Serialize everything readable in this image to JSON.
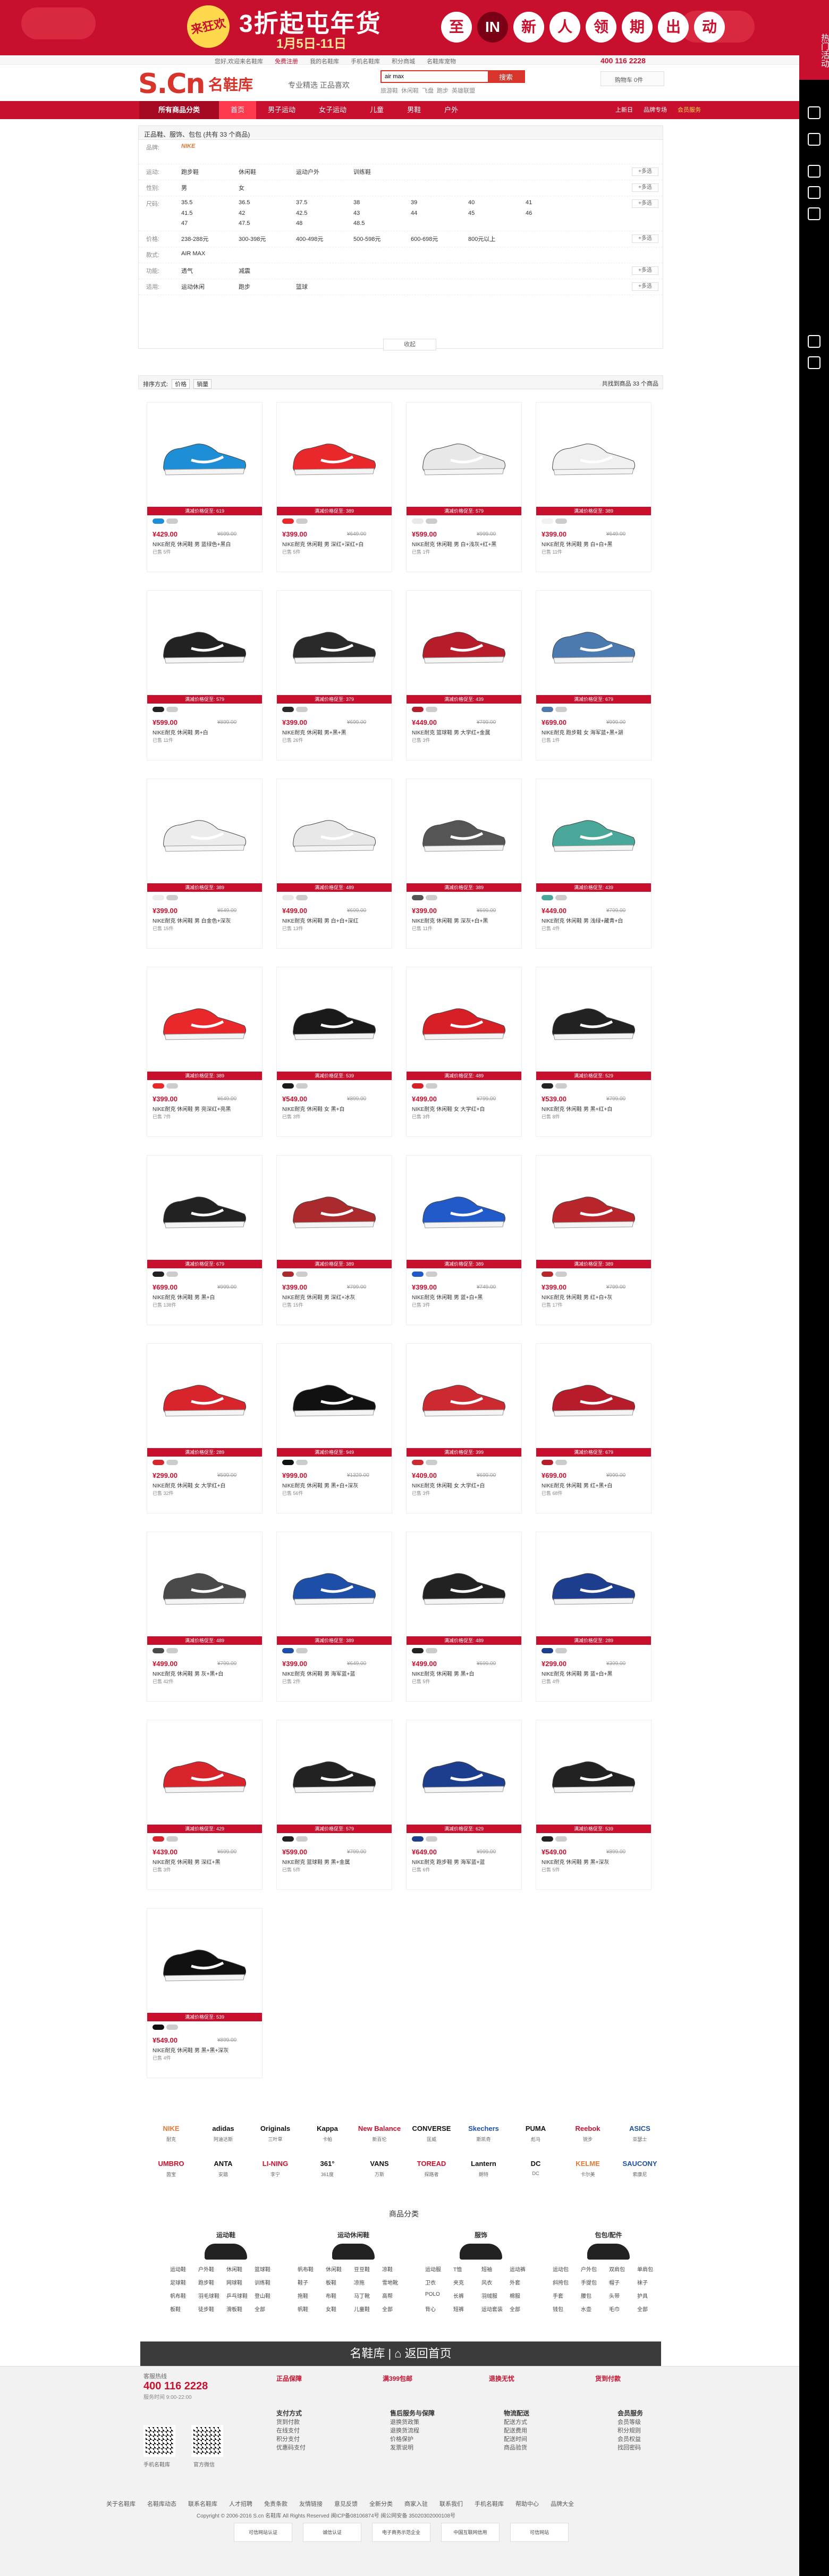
{
  "promo": {
    "badge": "来狂欢",
    "headline": "3折起屯年货",
    "dates": "1月5日-11日",
    "chips": [
      "至",
      "IN",
      "新",
      "人",
      "领",
      "期",
      "出",
      "动"
    ]
  },
  "side": {
    "hot": "热门活动"
  },
  "topbar": {
    "links": [
      "您好,欢迎来名鞋库",
      "免费注册",
      "我的名鞋库",
      "手机名鞋库",
      "积分商城",
      "名鞋库宠物"
    ],
    "phone": "400 116 2228"
  },
  "header": {
    "logo": "S.Cn",
    "logo_cn": "名鞋库",
    "slogan": "专业精选 正品喜欢",
    "search_value": "air max",
    "search_button": "搜索",
    "hotwords": [
      "旅游鞋",
      "休闲鞋",
      "飞盘",
      "跑步",
      "英雄联盟"
    ],
    "cart": "购物车 0件"
  },
  "nav": {
    "all": "所有商品分类",
    "items": [
      "首页",
      "男子运动",
      "女子运动",
      "儿童",
      "男鞋",
      "户外"
    ],
    "right": [
      "上新日",
      "品牌专场"
    ],
    "right_hl": "会员服务"
  },
  "filter": {
    "crumb": "正品鞋、服饰、包包 (共有 33 个商品)",
    "rows": [
      {
        "label": "品牌:",
        "values": [
          "NIKE"
        ]
      },
      {
        "label": "运动:",
        "values": [
          "跑步鞋",
          "休闲鞋",
          "运动户外",
          "训练鞋"
        ],
        "more": "+多选"
      },
      {
        "label": "性别:",
        "values": [
          "男",
          "女"
        ],
        "more": "+多选"
      },
      {
        "label": "尺码:",
        "values": [
          "35.5",
          "36.5",
          "37.5",
          "38",
          "39",
          "40",
          "41",
          "41.5",
          "42",
          "42.5",
          "43",
          "44",
          "45",
          "46",
          "47",
          "47.5",
          "48",
          "48.5"
        ],
        "more": "+多选"
      },
      {
        "label": "价格:",
        "values": [
          "238-288元",
          "300-398元",
          "400-498元",
          "500-598元",
          "600-698元",
          "800元以上"
        ],
        "more": "+多选"
      },
      {
        "label": "款式:",
        "values": [
          "AIR MAX"
        ]
      },
      {
        "label": "功能:",
        "values": [
          "透气",
          "减震"
        ],
        "more": "+多选"
      },
      {
        "label": "适用:",
        "values": [
          "运动休闲",
          "跑步",
          "篮球"
        ],
        "more": "+多选"
      }
    ],
    "collapse": "收起"
  },
  "sortbar": {
    "label": "排序方式:",
    "btn1": "价格",
    "btn2": "销量",
    "count": "共找到商品 33 个商品"
  },
  "products": [
    {
      "ribbon": "满减价格促至: 619",
      "price": "¥429.00",
      "orig": "¥699.00",
      "name": "NIKE耐克 休闲鞋 男 蓝绿色+黑白",
      "sold": "已售 5件"
    },
    {
      "ribbon": "满减价格促至: 389",
      "price": "¥399.00",
      "orig": "¥649.00",
      "name": "NIKE耐克 休闲鞋 男 深红+深红+白",
      "sold": "已售 5件"
    },
    {
      "ribbon": "满减价格促至: 579",
      "price": "¥599.00",
      "orig": "¥999.00",
      "name": "NIKE耐克 休闲鞋 男 白+浅灰+红+黑",
      "sold": "已售 1件"
    },
    {
      "ribbon": "满减价格促至: 389",
      "price": "¥399.00",
      "orig": "¥649.00",
      "name": "NIKE耐克 休闲鞋 男 白+白+黑",
      "sold": "已售 11件"
    },
    {
      "ribbon": "满减价格促至: 579",
      "price": "¥599.00",
      "orig": "¥899.00",
      "name": "NIKE耐克 休闲鞋 男+白",
      "sold": "已售 11件"
    },
    {
      "ribbon": "满减价格促至: 379",
      "price": "¥399.00",
      "orig": "¥699.00",
      "name": "NIKE耐克 休闲鞋 男+黑+黑",
      "sold": "已售 26件"
    },
    {
      "ribbon": "满减价格促至: 439",
      "price": "¥449.00",
      "orig": "¥799.00",
      "name": "NIKE耐克 篮球鞋 男 大学红+金属",
      "sold": "已售 3件"
    },
    {
      "ribbon": "满减价格促至: 679",
      "price": "¥699.00",
      "orig": "¥999.00",
      "name": "NIKE耐克 跑步鞋 女 海军蓝+黑+湖",
      "sold": "已售 1件"
    },
    {
      "ribbon": "满减价格促至: 389",
      "price": "¥399.00",
      "orig": "¥649.00",
      "name": "NIKE耐克 休闲鞋 男 白金色+深灰",
      "sold": "已售 15件"
    },
    {
      "ribbon": "满减价格促至: 489",
      "price": "¥499.00",
      "orig": "¥699.00",
      "name": "NIKE耐克 休闲鞋 男 白+白+深红",
      "sold": "已售 13件"
    },
    {
      "ribbon": "满减价格促至: 389",
      "price": "¥399.00",
      "orig": "¥699.00",
      "name": "NIKE耐克 休闲鞋 男 深灰+白+黑",
      "sold": "已售 11件"
    },
    {
      "ribbon": "满减价格促至: 439",
      "price": "¥449.00",
      "orig": "¥799.00",
      "name": "NIKE耐克 休闲鞋 男 浅绿+藏青+白",
      "sold": "已售 4件"
    },
    {
      "ribbon": "满减价格促至: 389",
      "price": "¥399.00",
      "orig": "¥649.00",
      "name": "NIKE耐克 休闲鞋 男 亮深红+亮黑",
      "sold": "已售 7件"
    },
    {
      "ribbon": "满减价格促至: 539",
      "price": "¥549.00",
      "orig": "¥899.00",
      "name": "NIKE耐克 休闲鞋 女 黑+白",
      "sold": "已售 3件"
    },
    {
      "ribbon": "满减价格促至: 489",
      "price": "¥499.00",
      "orig": "¥799.00",
      "name": "NIKE耐克 休闲鞋 女 大学红+白",
      "sold": "已售 3件"
    },
    {
      "ribbon": "满减价格促至: 529",
      "price": "¥539.00",
      "orig": "¥799.00",
      "name": "NIKE耐克 休闲鞋 男 黑+红+白",
      "sold": "已售 8件"
    },
    {
      "ribbon": "满减价格促至: 679",
      "price": "¥699.00",
      "orig": "¥999.00",
      "name": "NIKE耐克 休闲鞋 男 黑+白",
      "sold": "已售 138件"
    },
    {
      "ribbon": "满减价格促至: 389",
      "price": "¥399.00",
      "orig": "¥799.00",
      "name": "NIKE耐克 休闲鞋 男 深红+冰灰",
      "sold": "已售 15件"
    },
    {
      "ribbon": "满减价格促至: 389",
      "price": "¥399.00",
      "orig": "¥749.00",
      "name": "NIKE耐克 休闲鞋 男 蓝+白+黑",
      "sold": "已售 3件"
    },
    {
      "ribbon": "满减价格促至: 389",
      "price": "¥399.00",
      "orig": "¥799.00",
      "name": "NIKE耐克 休闲鞋 男 红+白+灰",
      "sold": "已售 17件"
    },
    {
      "ribbon": "满减价格促至: 289",
      "price": "¥299.00",
      "orig": "¥599.00",
      "name": "NIKE耐克 休闲鞋 女 大学红+白",
      "sold": "已售 32件"
    },
    {
      "ribbon": "满减价格促至: 949",
      "price": "¥999.00",
      "orig": "¥1329.00",
      "name": "NIKE耐克 休闲鞋 男 黑+白+深灰",
      "sold": "已售 56件"
    },
    {
      "ribbon": "满减价格促至: 399",
      "price": "¥409.00",
      "orig": "¥699.00",
      "name": "NIKE耐克 休闲鞋 女 大学红+白",
      "sold": "已售 3件"
    },
    {
      "ribbon": "满减价格促至: 679",
      "price": "¥699.00",
      "orig": "¥999.00",
      "name": "NIKE耐克 休闲鞋 男 红+黑+白",
      "sold": "已售 68件"
    },
    {
      "ribbon": "满减价格促至: 489",
      "price": "¥499.00",
      "orig": "¥799.00",
      "name": "NIKE耐克 休闲鞋 男 灰+黑+白",
      "sold": "已售 42件"
    },
    {
      "ribbon": "满减价格促至: 389",
      "price": "¥399.00",
      "orig": "¥649.00",
      "name": "NIKE耐克 休闲鞋 男 海军蓝+蓝",
      "sold": "已售 2件"
    },
    {
      "ribbon": "满减价格促至: 489",
      "price": "¥499.00",
      "orig": "¥699.00",
      "name": "NIKE耐克 休闲鞋 男 黑+白",
      "sold": "已售 5件"
    },
    {
      "ribbon": "满减价格促至: 289",
      "price": "¥299.00",
      "orig": "¥399.00",
      "name": "NIKE耐克 休闲鞋 男 蓝+白+黑",
      "sold": "已售 4件"
    },
    {
      "ribbon": "满减价格促至: 429",
      "price": "¥439.00",
      "orig": "¥699.00",
      "name": "NIKE耐克 休闲鞋 男 深红+黑",
      "sold": "已售 3件"
    },
    {
      "ribbon": "满减价格促至: 579",
      "price": "¥599.00",
      "orig": "¥799.00",
      "name": "NIKE耐克 篮球鞋 男 黑+金属",
      "sold": "已售 5件"
    },
    {
      "ribbon": "满减价格促至: 629",
      "price": "¥649.00",
      "orig": "¥999.00",
      "name": "NIKE耐克 跑步鞋 男 海军蓝+蓝",
      "sold": "已售 6件"
    },
    {
      "ribbon": "满减价格促至: 539",
      "price": "¥549.00",
      "orig": "¥899.00",
      "name": "NIKE耐克 休闲鞋 男 黑+深灰",
      "sold": "已售 5件"
    },
    {
      "ribbon": "满减价格促至: 539",
      "price": "¥549.00",
      "orig": "¥899.00",
      "name": "NIKE耐克 休闲鞋 男 黑+黑+深灰",
      "sold": "已售 4件"
    }
  ],
  "product_colors": [
    "#1e8fd6",
    "#e8282b",
    "#e8e8e8",
    "#f0f0f0",
    "#222",
    "#2a2a2a",
    "#b71c2a",
    "#4a7ab0",
    "#ececec",
    "#e8e8e8",
    "#555",
    "#4aa89a",
    "#e8282b",
    "#1a1a1a",
    "#d71f26",
    "#222",
    "#222",
    "#aa2a2e",
    "#2159c8",
    "#b8252b",
    "#d8252c",
    "#111",
    "#cc2a30",
    "#b71c2a",
    "#4a4a4a",
    "#1d4fa8",
    "#222",
    "#1d3d8f",
    "#d8252c",
    "#222",
    "#1d3d8f",
    "#222",
    "#111"
  ],
  "brands": [
    {
      "logo": "NIKE",
      "name": "耐克",
      "color": "#e47833"
    },
    {
      "logo": "adidas",
      "name": "阿迪达斯",
      "color": "#111"
    },
    {
      "logo": "Originals",
      "name": "三叶草",
      "color": "#111"
    },
    {
      "logo": "Kappa",
      "name": "卡帕",
      "color": "#111"
    },
    {
      "logo": "New Balance",
      "name": "新百伦",
      "color": "#c8102e"
    },
    {
      "logo": "CONVERSE",
      "name": "匡威",
      "color": "#111"
    },
    {
      "logo": "Skechers",
      "name": "斯凯奇",
      "color": "#1e4fa8"
    },
    {
      "logo": "PUMA",
      "name": "彪马",
      "color": "#111"
    },
    {
      "logo": "Reebok",
      "name": "锐步",
      "color": "#c8102e"
    },
    {
      "logo": "ASICS",
      "name": "亚瑟士",
      "color": "#1e4fa8"
    },
    {
      "logo": "UMBRO",
      "name": "茵宝",
      "color": "#c8102e"
    },
    {
      "logo": "ANTA",
      "name": "安踏",
      "color": "#111"
    },
    {
      "logo": "LI-NING",
      "name": "李宁",
      "color": "#c8102e"
    },
    {
      "logo": "361°",
      "name": "361度",
      "color": "#111"
    },
    {
      "logo": "VANS",
      "name": "万斯",
      "color": "#111"
    },
    {
      "logo": "TOREAD",
      "name": "探路者",
      "color": "#c8102e"
    },
    {
      "logo": "Lantern",
      "name": "朗特",
      "color": "#111"
    },
    {
      "logo": "DC",
      "name": "DC",
      "color": "#111"
    },
    {
      "logo": "KELME",
      "name": "卡尔美",
      "color": "#e47833"
    },
    {
      "logo": "SAUCONY",
      "name": "索康尼",
      "color": "#1e4fa8"
    }
  ],
  "cats": {
    "title": "商品分类",
    "cols": [
      {
        "head": "运动鞋",
        "items": [
          "运动鞋",
          "户外鞋",
          "休闲鞋",
          "篮球鞋",
          "足球鞋",
          "跑步鞋",
          "网球鞋",
          "训练鞋",
          "帆布鞋",
          "羽毛球鞋",
          "乒乓球鞋",
          "登山鞋",
          "板鞋",
          "徒步鞋",
          "滑板鞋",
          "全部"
        ]
      },
      {
        "head": "运动休闲鞋",
        "items": [
          "帆布鞋",
          "休闲鞋",
          "豆豆鞋",
          "凉鞋",
          "鞋子",
          "板鞋",
          "凉拖",
          "雪地靴",
          "拖鞋",
          "布鞋",
          "马丁靴",
          "高帮",
          "帆鞋",
          "女鞋",
          "儿童鞋",
          "全部"
        ]
      },
      {
        "head": "服饰",
        "items": [
          "运动服",
          "T恤",
          "短袖",
          "运动裤",
          "卫衣",
          "夹克",
          "风衣",
          "外套",
          "POLO",
          "长裤",
          "羽绒服",
          "棉服",
          "背心",
          "短裤",
          "运动套装",
          "全部"
        ]
      },
      {
        "head": "包包/配件",
        "items": [
          "运动包",
          "户外包",
          "双肩包",
          "单肩包",
          "斜挎包",
          "手提包",
          "帽子",
          "袜子",
          "手套",
          "腰包",
          "头带",
          "护具",
          "钱包",
          "水壶",
          "毛巾",
          "全部"
        ]
      }
    ]
  },
  "backhome": "名鞋库 | ⌂ 返回首页",
  "footer": {
    "hotline_label": "客服热线",
    "hotline": "400 116 2228",
    "service_time": "服务时间 9:00-22:00",
    "svc": [
      "正品保障",
      "满399包邮",
      "退换无忧",
      "货到付款"
    ],
    "cols": [
      {
        "head": "支付方式",
        "items": [
          "货到付款",
          "在线支付",
          "积分支付",
          "优惠码支付"
        ]
      },
      {
        "head": "售后服务与保障",
        "items": [
          "退换货政策",
          "退换货流程",
          "价格保护",
          "发票说明"
        ]
      },
      {
        "head": "物流配送",
        "items": [
          "配送方式",
          "配送费用",
          "配送时间",
          "商品验货"
        ]
      },
      {
        "head": "会员服务",
        "items": [
          "会员等级",
          "积分规则",
          "会员权益",
          "找回密码"
        ]
      }
    ],
    "qr1": "手机名鞋库",
    "qr2": "官方微信",
    "links": [
      "关于名鞋库",
      "名鞋库动态",
      "联系名鞋库",
      "人才招聘",
      "免责条款",
      "友情链接",
      "意见反馈",
      "全新分类",
      "商家入驻",
      "联系我们",
      "手机名鞋库",
      "帮助中心",
      "品牌大全"
    ],
    "copyright": "Copyright © 2006-2016 S.cn 名鞋库 All Rights Reserved  闽ICP备08106874号  闽公网安备 35020302000108号",
    "certs": [
      "可信网站认证",
      "诚信认证",
      "电子商务示范企业",
      "中国互联网信用",
      "可信网站"
    ]
  }
}
